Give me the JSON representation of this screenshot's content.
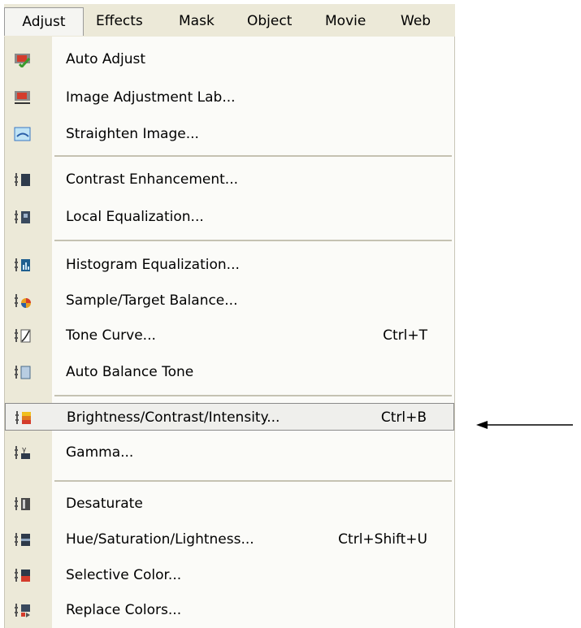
{
  "menubar": {
    "items": [
      {
        "label": "Adjust",
        "active": true
      },
      {
        "label": "Effects",
        "active": false
      },
      {
        "label": "Mask",
        "active": false
      },
      {
        "label": "Object",
        "active": false
      },
      {
        "label": "Movie",
        "active": false
      },
      {
        "label": "Web",
        "active": false
      }
    ]
  },
  "menu": {
    "items": [
      {
        "label": "Auto Adjust",
        "shortcut": "",
        "icon": "auto-adjust-icon"
      },
      {
        "label": "Image Adjustment Lab...",
        "shortcut": "",
        "icon": "image-adjustment-lab-icon"
      },
      {
        "label": "Straighten Image...",
        "shortcut": "",
        "icon": "straighten-image-icon"
      },
      {
        "label": "Contrast Enhancement...",
        "shortcut": "",
        "icon": "contrast-enhancement-icon"
      },
      {
        "label": "Local Equalization...",
        "shortcut": "",
        "icon": "local-equalization-icon"
      },
      {
        "label": "Histogram Equalization...",
        "shortcut": "",
        "icon": "histogram-equalization-icon"
      },
      {
        "label": "Sample/Target Balance...",
        "shortcut": "",
        "icon": "sample-target-balance-icon"
      },
      {
        "label": "Tone Curve...",
        "shortcut": "Ctrl+T",
        "icon": "tone-curve-icon"
      },
      {
        "label": "Auto Balance Tone",
        "shortcut": "",
        "icon": "auto-balance-tone-icon"
      },
      {
        "label": "Brightness/Contrast/Intensity...",
        "shortcut": "Ctrl+B",
        "icon": "brightness-contrast-intensity-icon",
        "highlighted": true
      },
      {
        "label": "Gamma...",
        "shortcut": "",
        "icon": "gamma-icon"
      },
      {
        "label": "Desaturate",
        "shortcut": "",
        "icon": "desaturate-icon"
      },
      {
        "label": "Hue/Saturation/Lightness...",
        "shortcut": "Ctrl+Shift+U",
        "icon": "hue-saturation-lightness-icon"
      },
      {
        "label": "Selective Color...",
        "shortcut": "",
        "icon": "selective-color-icon"
      },
      {
        "label": "Replace Colors...",
        "shortcut": "",
        "icon": "replace-colors-icon"
      }
    ]
  },
  "annotation": {
    "arrow_icon": "left-arrow-icon"
  },
  "colors": {
    "menubar_bg": "#ece9d8",
    "menu_bg": "#fbfbf8",
    "highlight_border": "#8a8a8a"
  }
}
